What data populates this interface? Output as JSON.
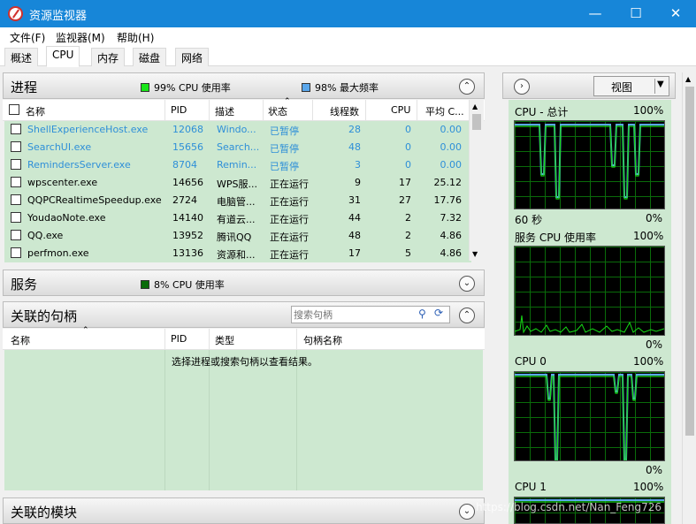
{
  "window": {
    "title": "资源监视器",
    "minimize": "—",
    "maximize": "☐",
    "close": "✕"
  },
  "menu": [
    "文件(F)",
    "监视器(M)",
    "帮助(H)"
  ],
  "tabs": [
    "概述",
    "CPU",
    "内存",
    "磁盘",
    "网络"
  ],
  "active_tab": "CPU",
  "colors": {
    "titlebar": "#1786d8",
    "row_bg": "#cde8d0",
    "link_blue": "#2e8fd8",
    "graph_line": "#16d916",
    "cpu_swatch": "#19e619",
    "freq_swatch": "#5aa7ec"
  },
  "processes": {
    "title": "进程",
    "cpu_usage": "99% CPU 使用率",
    "max_freq": "98% 最大频率",
    "headers": {
      "name": "名称",
      "pid": "PID",
      "desc": "描述",
      "status": "状态",
      "threads": "线程数",
      "cpu": "CPU",
      "avg": "平均 C..."
    },
    "rows": [
      {
        "name": "ShellExperienceHost.exe",
        "pid": "12068",
        "desc": "Windo...",
        "status": "已暂停",
        "threads": "28",
        "cpu": "0",
        "avg": "0.00",
        "suspended": true
      },
      {
        "name": "SearchUI.exe",
        "pid": "15656",
        "desc": "Search...",
        "status": "已暂停",
        "threads": "48",
        "cpu": "0",
        "avg": "0.00",
        "suspended": true
      },
      {
        "name": "RemindersServer.exe",
        "pid": "8704",
        "desc": "Remin...",
        "status": "已暂停",
        "threads": "3",
        "cpu": "0",
        "avg": "0.00",
        "suspended": true
      },
      {
        "name": "wpscenter.exe",
        "pid": "14656",
        "desc": "WPS服...",
        "status": "正在运行",
        "threads": "9",
        "cpu": "17",
        "avg": "25.12",
        "suspended": false
      },
      {
        "name": "QQPCRealtimeSpeedup.exe",
        "pid": "2724",
        "desc": "电脑管...",
        "status": "正在运行",
        "threads": "31",
        "cpu": "27",
        "avg": "17.76",
        "suspended": false
      },
      {
        "name": "YoudaoNote.exe",
        "pid": "14140",
        "desc": "有道云...",
        "status": "正在运行",
        "threads": "44",
        "cpu": "2",
        "avg": "7.32",
        "suspended": false
      },
      {
        "name": "QQ.exe",
        "pid": "13952",
        "desc": "腾讯QQ",
        "status": "正在运行",
        "threads": "48",
        "cpu": "2",
        "avg": "4.86",
        "suspended": false
      },
      {
        "name": "perfmon.exe",
        "pid": "13136",
        "desc": "资源和...",
        "status": "正在运行",
        "threads": "17",
        "cpu": "5",
        "avg": "4.86",
        "suspended": false
      }
    ]
  },
  "services": {
    "title": "服务",
    "cpu_usage": "8% CPU 使用率"
  },
  "handles": {
    "title": "关联的句柄",
    "search_placeholder": "搜索句柄",
    "headers": {
      "name": "名称",
      "pid": "PID",
      "type": "类型",
      "handle_name": "句柄名称"
    },
    "empty_message": "选择进程或搜索句柄以查看结果。"
  },
  "modules": {
    "title": "关联的模块"
  },
  "graphs": {
    "view_button": "视图",
    "cpu_total": {
      "label": "CPU - 总计",
      "max": "100%",
      "time": "60 秒",
      "min": "0%"
    },
    "service_cpu": {
      "label": "服务 CPU 使用率",
      "max": "100%",
      "min": "0%"
    },
    "cpu0": {
      "label": "CPU 0",
      "max": "100%",
      "min": "0%"
    },
    "cpu1": {
      "label": "CPU 1",
      "max": "100%"
    }
  },
  "watermark": "https://blog.csdn.net/Nan_Feng726"
}
